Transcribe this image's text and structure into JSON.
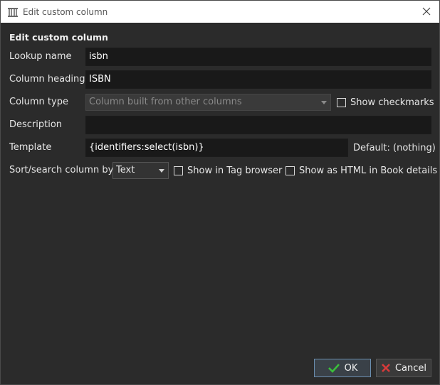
{
  "window": {
    "title": "Edit custom column"
  },
  "form": {
    "heading": "Edit custom column",
    "lookup_label": "Lookup name",
    "lookup_value": "isbn",
    "heading_label": "Column heading",
    "heading_value": "ISBN",
    "type_label": "Column type",
    "type_value": "Column built from other columns",
    "show_checkmarks_label": "Show checkmarks",
    "description_label": "Description",
    "description_value": "",
    "template_label": "Template",
    "template_value": "{identifiers:select(isbn)}",
    "default_label": "Default: (nothing)",
    "sort_label": "Sort/search column by",
    "sort_value": "Text",
    "tag_browser_label": "Show in Tag browser",
    "html_label": "Show as HTML in Book details"
  },
  "buttons": {
    "ok": "OK",
    "cancel": "Cancel"
  },
  "colors": {
    "background": "#2b2b2b",
    "ok_check": "#3bbf3b",
    "cancel_x": "#d93a3a"
  }
}
